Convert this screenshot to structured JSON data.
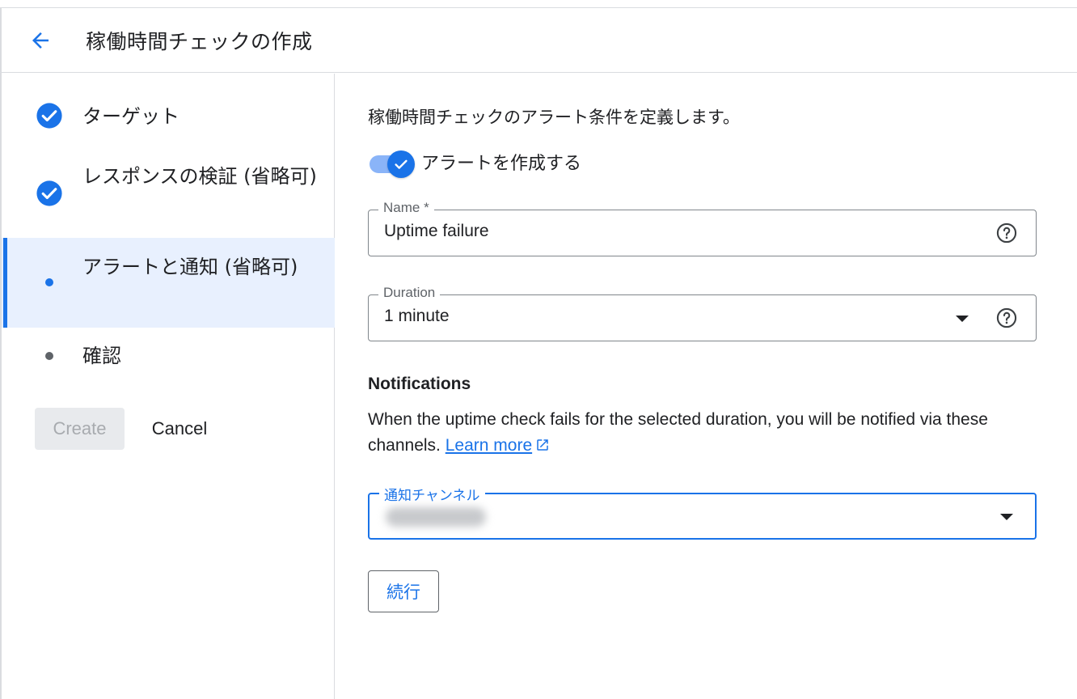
{
  "header": {
    "title": "稼働時間チェックの作成",
    "back_icon": "arrow-back-icon"
  },
  "steps": [
    {
      "label": "ターゲット",
      "state": "complete"
    },
    {
      "label": "レスポンスの検証 (省略可)",
      "state": "complete"
    },
    {
      "label": "アラートと通知 (省略可)",
      "state": "active"
    },
    {
      "label": "確認",
      "state": "pending"
    }
  ],
  "actions": {
    "create_label": "Create",
    "cancel_label": "Cancel"
  },
  "form": {
    "intro": "稼働時間チェックのアラート条件を定義します。",
    "toggle_label": "アラートを作成する",
    "toggle_on": true,
    "name_label": "Name *",
    "name_value": "Uptime failure",
    "duration_label": "Duration",
    "duration_value": "1 minute",
    "notifications_title": "Notifications",
    "notifications_desc": "When the uptime check fails for the selected duration, you will be notified via these channels. ",
    "learn_more": "Learn more",
    "channel_label": "通知チャンネル",
    "continue_label": "続行"
  },
  "colors": {
    "accent": "#1a73e8",
    "active_bg": "#e8f0fe"
  }
}
